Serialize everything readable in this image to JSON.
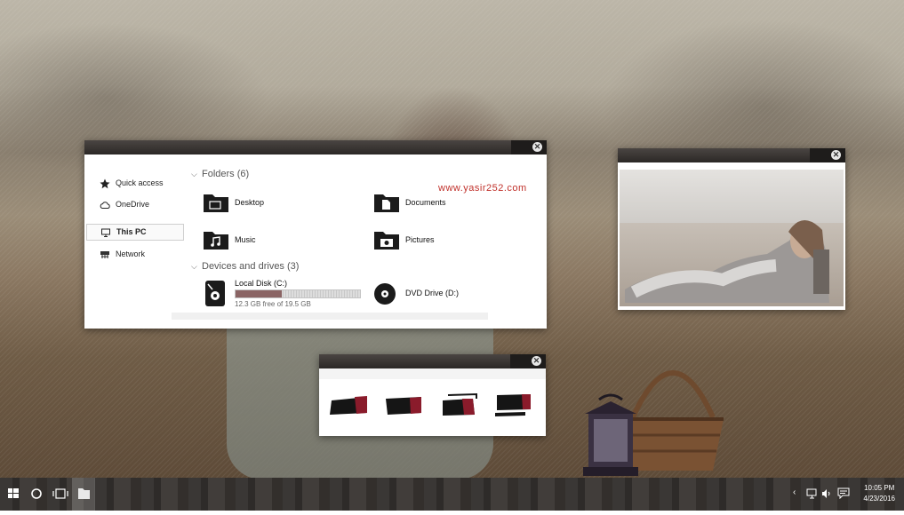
{
  "explorer": {
    "nav": [
      {
        "label": "Quick access",
        "icon": "star-icon"
      },
      {
        "label": "OneDrive",
        "icon": "cloud-icon"
      },
      {
        "label": "This PC",
        "icon": "monitor-icon",
        "selected": true
      },
      {
        "label": "Network",
        "icon": "network-icon"
      }
    ],
    "folders_header": "Folders (6)",
    "folders": [
      {
        "name": "Desktop",
        "icon": "desktop-folder-icon"
      },
      {
        "name": "Documents",
        "icon": "documents-folder-icon"
      },
      {
        "name": "Music",
        "icon": "music-folder-icon"
      },
      {
        "name": "Pictures",
        "icon": "pictures-folder-icon"
      }
    ],
    "devices_header": "Devices and drives (3)",
    "drives": [
      {
        "name": "Local Disk (C:)",
        "free": "12.3 GB free of 19.5 GB",
        "used_fraction": 0.37
      },
      {
        "name": "DVD Drive (D:)"
      }
    ],
    "watermark": "www.yasir252.com"
  },
  "taskbar": {
    "time": "10:05 PM",
    "date": "4/23/2016",
    "tray_arrow": "‹"
  },
  "colors": {
    "accent": "#8a1b2b",
    "titlebar": "#2b2826"
  }
}
